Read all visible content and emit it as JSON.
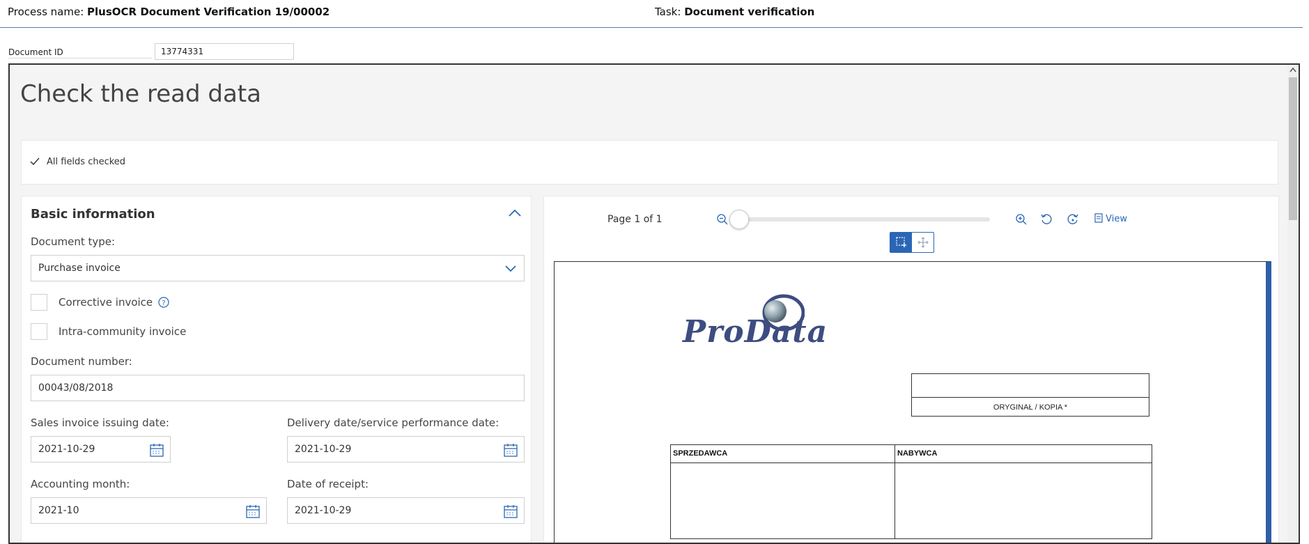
{
  "header": {
    "process_label": "Process name:",
    "process_value": "PlusOCR Document Verification 19/00002",
    "task_label": "Task:",
    "task_value": "Document verification"
  },
  "document_id": {
    "label": "Document ID",
    "value": "13774331"
  },
  "page": {
    "title": "Check the read data",
    "status_text": "All fields checked"
  },
  "basic_info": {
    "title": "Basic information",
    "document_type_label": "Document type:",
    "document_type_value": "Purchase invoice",
    "corrective_label": "Corrective invoice",
    "intra_community_label": "Intra-community invoice",
    "document_number_label": "Document number:",
    "document_number_value": "00043/08/2018",
    "issuing_date_label": "Sales invoice issuing date:",
    "issuing_date_value": "2021-10-29",
    "delivery_date_label": "Delivery date/service performance date:",
    "delivery_date_value": "2021-10-29",
    "accounting_month_label": "Accounting month:",
    "accounting_month_value": "2021-10",
    "receipt_date_label": "Date of receipt:",
    "receipt_date_value": "2021-10-29"
  },
  "viewer": {
    "page_indicator": "Page 1 of 1",
    "view_label": "View",
    "zoom_level": 0
  },
  "document_preview": {
    "logo_text": "ProData",
    "original_copy_text": "ORYGINAŁ /  KOPIA *",
    "seller_header": "SPRZEDAWCA",
    "buyer_header": "NABYWCA"
  },
  "colors": {
    "accent": "#2a66b5",
    "doc_bar": "#2f5ea8",
    "logo": "#3d4d80"
  }
}
